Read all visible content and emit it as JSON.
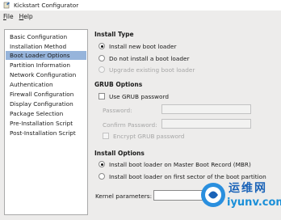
{
  "window": {
    "title": "Kickstart Configurator"
  },
  "menu": [
    {
      "prefix": "",
      "key": "F",
      "rest": "ile"
    },
    {
      "prefix": "",
      "key": "H",
      "rest": "elp"
    }
  ],
  "sidebar": {
    "items": [
      {
        "label": "Basic Configuration",
        "selected": false
      },
      {
        "label": "Installation Method",
        "selected": false
      },
      {
        "label": "Boot Loader Options",
        "selected": true
      },
      {
        "label": "Partition Information",
        "selected": false
      },
      {
        "label": "Network Configuration",
        "selected": false
      },
      {
        "label": "Authentication",
        "selected": false
      },
      {
        "label": "Firewall Configuration",
        "selected": false
      },
      {
        "label": "Display Configuration",
        "selected": false
      },
      {
        "label": "Package Selection",
        "selected": false
      },
      {
        "label": "Pre-Installation Script",
        "selected": false
      },
      {
        "label": "Post-Installation Script",
        "selected": false
      }
    ]
  },
  "install_type": {
    "title": "Install Type",
    "options": [
      {
        "label": "Install new boot loader",
        "checked": true,
        "disabled": false
      },
      {
        "label": "Do not install a boot loader",
        "checked": false,
        "disabled": false
      },
      {
        "label": "Upgrade existing boot loader",
        "checked": false,
        "disabled": true
      }
    ]
  },
  "grub_options": {
    "title": "GRUB Options",
    "use_grub_password": "Use GRUB password",
    "password_label": "Password:",
    "confirm_label": "Confirm Password:",
    "encrypt_label": "Encrypt GRUB password"
  },
  "install_options": {
    "title": "Install Options",
    "options": [
      {
        "label": "Install boot loader on Master Boot Record (MBR)",
        "checked": true
      },
      {
        "label": "Install boot loader on first sector of the boot partition",
        "checked": false
      }
    ],
    "kernel_label": "Kernel parameters:",
    "kernel_value": ""
  },
  "watermark": {
    "cn": "运维网",
    "url": "iyunv.com"
  }
}
